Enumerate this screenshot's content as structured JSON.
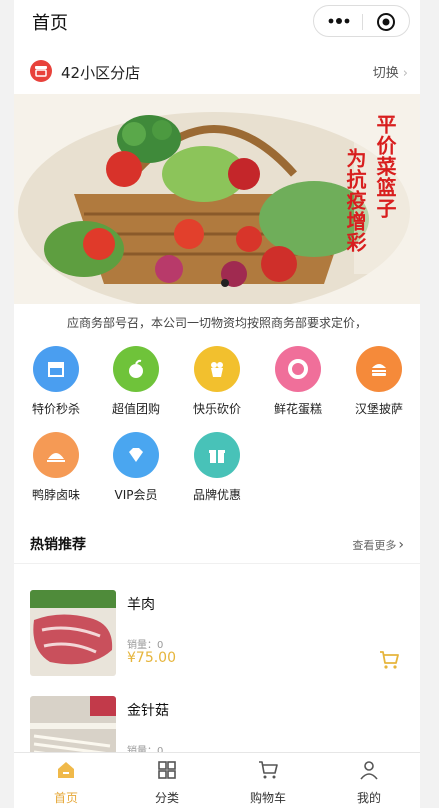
{
  "navbar": {
    "title": "首页"
  },
  "store": {
    "name": "42小区分店",
    "switch_label": "切换"
  },
  "banner": {
    "line1": "平价菜篮子",
    "line2": "为抗疫增彩"
  },
  "notice": "应商务部号召，本公司一切物资均按照商务部要求定价，",
  "categories": [
    {
      "label": "特价秒杀",
      "icon": "store-icon",
      "color": "#4a9ef0"
    },
    {
      "label": "超值团购",
      "icon": "apple-icon",
      "color": "#6fc33a"
    },
    {
      "label": "快乐砍价",
      "icon": "popcorn-icon",
      "color": "#f2c02e"
    },
    {
      "label": "鲜花蛋糕",
      "icon": "donut-icon",
      "color": "#f06f9a"
    },
    {
      "label": "汉堡披萨",
      "icon": "burger-icon",
      "color": "#f58a3a"
    },
    {
      "label": "鸭脖卤味",
      "icon": "dish-icon",
      "color": "#f59a55"
    },
    {
      "label": "VIP会员",
      "icon": "diamond-icon",
      "color": "#4aa6f0"
    },
    {
      "label": "品牌优惠",
      "icon": "gift-icon",
      "color": "#48c2b8"
    }
  ],
  "hot": {
    "title": "热销推荐",
    "more_label": "查看更多"
  },
  "products": [
    {
      "name": "羊肉",
      "sales": "销量：0",
      "price": "¥75.00"
    },
    {
      "name": "金针菇",
      "sales": "销量：0",
      "price": ""
    }
  ],
  "tabbar": [
    {
      "label": "首页",
      "icon": "home-icon",
      "active": true
    },
    {
      "label": "分类",
      "icon": "category-icon",
      "active": false
    },
    {
      "label": "购物车",
      "icon": "cart-icon",
      "active": false
    },
    {
      "label": "我的",
      "icon": "user-icon",
      "active": false
    }
  ],
  "colors": {
    "accent": "#e6b53c",
    "brand_red": "#d81e1e"
  }
}
